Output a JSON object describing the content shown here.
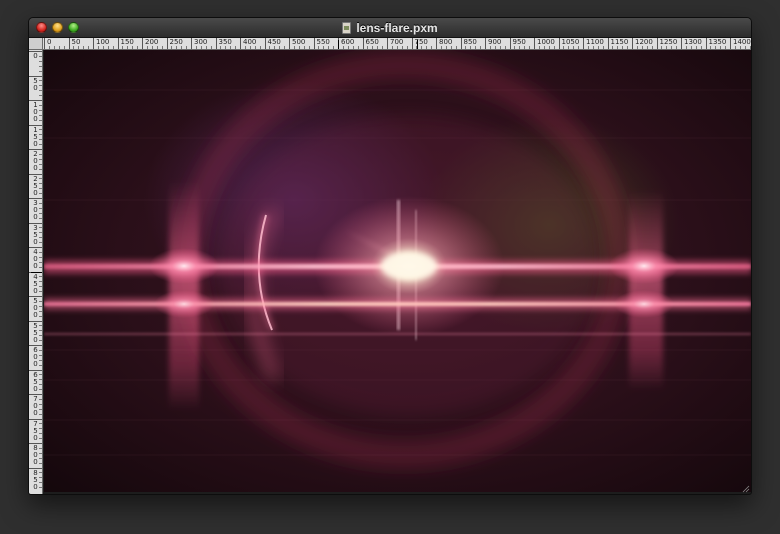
{
  "window": {
    "title": "lens-flare.pxm",
    "buttons": {
      "close": "close-button",
      "minimize": "minimize-button",
      "zoom": "zoom-button"
    }
  },
  "rulers": {
    "top_labels": [
      "0",
      "50",
      "100",
      "150",
      "200",
      "250",
      "300",
      "350",
      "400",
      "450",
      "500",
      "550",
      "600",
      "650",
      "700",
      "750",
      "800",
      "850",
      "900",
      "950",
      "1000",
      "1050",
      "1100",
      "1150",
      "1200",
      "1250",
      "1300",
      "1350",
      "1400"
    ],
    "left_labels": [
      "0",
      "50",
      "100",
      "150",
      "200",
      "250",
      "300",
      "350",
      "400",
      "450",
      "500",
      "550",
      "600",
      "650",
      "700",
      "750",
      "800",
      "850"
    ]
  },
  "image": {
    "name": "lens-flare",
    "colors": {
      "background": "#1e0b12",
      "flare_core": "#fff2d6",
      "flare_pink": "#ff5f8f",
      "flare_magenta": "#c2385f",
      "haze_purple": "#4a2451",
      "haze_olive": "#3a3a1f"
    }
  }
}
